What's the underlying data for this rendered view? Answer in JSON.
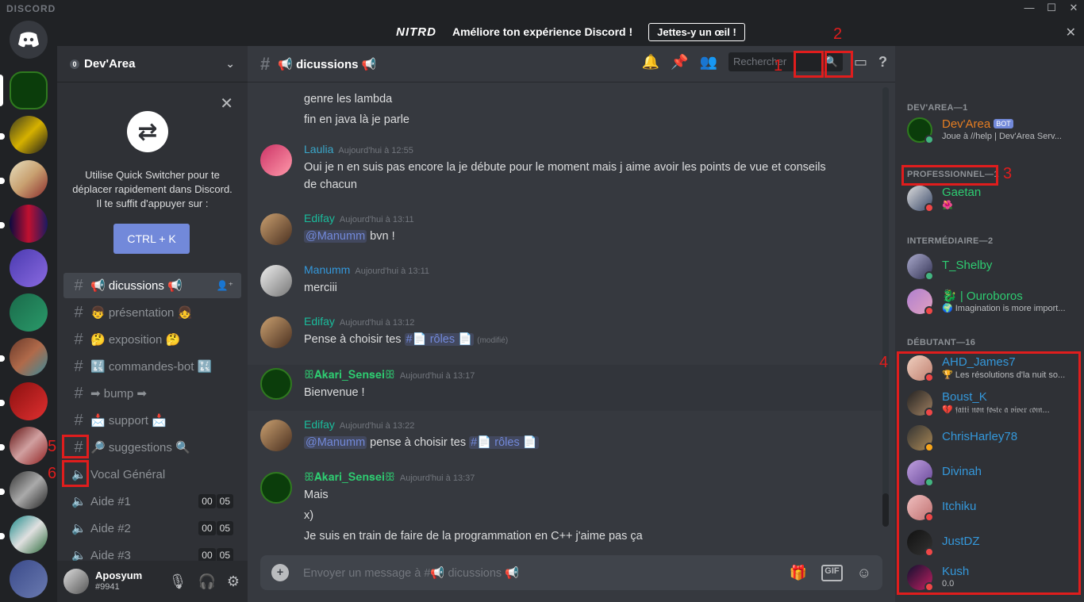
{
  "window": {
    "brand": "DISCORD",
    "min": "—",
    "max": "☐",
    "close": "✕"
  },
  "nitro": {
    "logo": "NITRD",
    "message": "Améliore ton expérience Discord !",
    "button": "Jettes-y un œil !",
    "close": "✕"
  },
  "server": {
    "name": "Dev'Area",
    "badge": "0"
  },
  "quick_switcher": {
    "text": "Utilise Quick Switcher pour te déplacer rapidement dans Discord. Il te suffit d'appuyer sur :",
    "button": "CTRL + K"
  },
  "channels": [
    {
      "name": "📢 dicussions 📢"
    },
    {
      "name": "👦 présentation 👧"
    },
    {
      "name": "🤔 exposition 🤔"
    },
    {
      "name": "🔣 commandes-bot 🔣"
    },
    {
      "name": "➡ bump ➡"
    },
    {
      "name": "📩 support 📩"
    },
    {
      "name": "🔎 suggestions 🔍"
    },
    {
      "name": "Vocal Général"
    },
    {
      "name": "Aide #1",
      "c1": "00",
      "c2": "05"
    },
    {
      "name": "Aide #2",
      "c1": "00",
      "c2": "05"
    },
    {
      "name": "Aide #3",
      "c1": "00",
      "c2": "05"
    }
  ],
  "user": {
    "name": "Aposyum",
    "tag": "#9941"
  },
  "chat": {
    "channel": "📢 dicussions 📢",
    "search": "Rechercher",
    "composer": "Envoyer un message à #📢 dicussions 📢",
    "gif": "GIF"
  },
  "messages": [
    {
      "lines": [
        "genre les lambda",
        "fin en java là je parle"
      ]
    },
    {
      "author": "Laulia",
      "time": "Aujourd'hui à 12:55",
      "lines": [
        "Oui je n en suis pas encore la je débute pour le moment mais j aime avoir les points de vue et conseils",
        "de chacun"
      ],
      "color": "#3aa7c9"
    },
    {
      "author": "Edifay",
      "time": "Aujourd'hui à 13:11",
      "mention": "@Manumm",
      "rest": " bvn !",
      "color": "#1abc9c"
    },
    {
      "author": "Manumm",
      "time": "Aujourd'hui à 13:11",
      "lines": [
        "merciii"
      ],
      "color": "#3498db"
    },
    {
      "author": "Edifay",
      "time": "Aujourd'hui à 13:12",
      "pre": "Pense à choisir tes ",
      "ch": "#📄 rôles 📄",
      "edited": "(modifié)",
      "color": "#1abc9c"
    },
    {
      "author": "ꕥ𝐀𝐤𝐚𝐫𝐢_𝐒𝐞𝐧𝐬𝐞𝐢ꕥ",
      "time": "Aujourd'hui à 13:17",
      "lines": [
        "Bienvenue !"
      ],
      "color": "#2ecc71"
    },
    {
      "author": "Edifay",
      "time": "Aujourd'hui à 13:22",
      "mention": "@Manumm",
      "mid": " pense à choisir tes ",
      "ch": "#📄 rôles 📄",
      "color": "#1abc9c"
    },
    {
      "author": "ꕥ𝐀𝐤𝐚𝐫𝐢_𝐒𝐞𝐧𝐬𝐞𝐢ꕥ",
      "time": "Aujourd'hui à 13:37",
      "lines": [
        "Mais",
        "x)",
        "Je suis en train de faire de la programmation en C++ j'aime pas ça"
      ],
      "color": "#2ecc71"
    }
  ],
  "groups": [
    "DEV'AREA—1",
    "PROFESSIONNEL—1",
    "INTERMÉDIAIRE—2",
    "DÉBUTANT—16"
  ],
  "member_list": [
    {
      "name": "Dev'Area",
      "status": "Joue à //help | Dev'Area Serv...",
      "bot": "BOT",
      "color": "#e67e22"
    },
    {
      "name": "Gaetan",
      "status": "🌺",
      "color": "#2ecc71"
    },
    {
      "name": "T_Shelby",
      "status": "",
      "color": "#2ecc71"
    },
    {
      "name": "🐉 | Ouroboros",
      "status": "🌍 Imagination is more import...",
      "color": "#2ecc71"
    },
    {
      "name": "AHD_James7",
      "status": "🏆 Les résolutions d'la nuit so...",
      "color": "#3498db"
    },
    {
      "name": "Boust_K",
      "status": "💔 𝔣𝔞𝔱𝔱𝔦 𝔫𝔬𝔫 𝔣𝔬𝔰𝔱𝔢 𝔞 𝔳𝔦𝔳𝔢𝔯 𝔠𝔬𝔪...",
      "color": "#3498db"
    },
    {
      "name": "ChrisHarley78",
      "status": "",
      "color": "#3498db"
    },
    {
      "name": "Divinah",
      "status": "",
      "color": "#3498db"
    },
    {
      "name": "Itchiku",
      "status": "",
      "color": "#3498db"
    },
    {
      "name": "JustDZ",
      "status": "",
      "color": "#3498db"
    },
    {
      "name": "Kush",
      "status": "0.0",
      "color": "#3498db"
    }
  ],
  "annotations": [
    "1",
    "2",
    "3",
    "4",
    "5",
    "6"
  ]
}
